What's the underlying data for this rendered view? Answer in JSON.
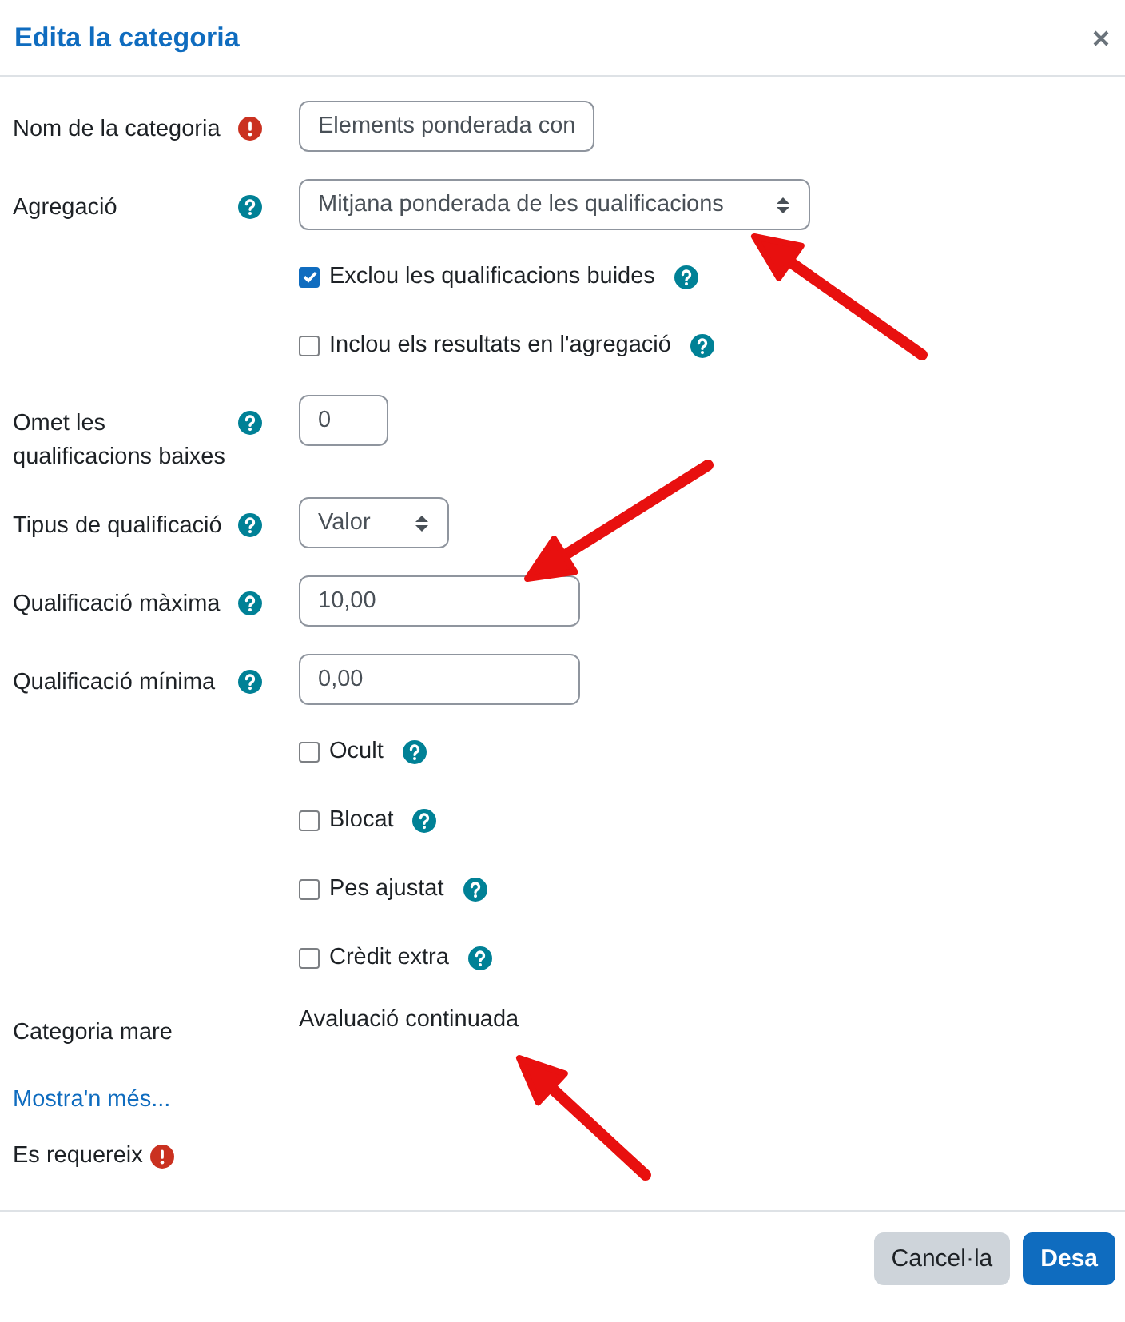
{
  "dialog": {
    "title": "Edita la categoria"
  },
  "rows": [
    {
      "kind": "text",
      "label": "Nom de la categoria",
      "required": true,
      "value": "Elements ponderada con"
    },
    {
      "kind": "select",
      "label": "Agregació",
      "required": false,
      "value": "Mitjana ponderada de les qualificacions"
    },
    {
      "kind": "checkbox",
      "text": "Exclou les qualificacions buides",
      "checked": true
    },
    {
      "kind": "checkbox",
      "text": "Inclou els resultats en l'agregació",
      "checked": false
    },
    {
      "kind": "text",
      "label": "Omet les qualificacions baixes",
      "required": false,
      "value": "0"
    },
    {
      "kind": "select",
      "label": "Tipus de qualificació",
      "required": false,
      "value": "Valor"
    },
    {
      "kind": "text",
      "label": "Qualificació màxima",
      "required": false,
      "value": "10,00"
    },
    {
      "kind": "text",
      "label": "Qualificació mínima",
      "required": false,
      "value": "0,00"
    },
    {
      "kind": "checkbox",
      "text": "Ocult",
      "checked": false
    },
    {
      "kind": "checkbox",
      "text": "Blocat",
      "checked": false
    },
    {
      "kind": "checkbox",
      "text": "Pes ajustat",
      "checked": false
    },
    {
      "kind": "checkbox",
      "text": "Crèdit extra",
      "checked": false
    },
    {
      "kind": "static",
      "label": "Categoria mare",
      "value": "Avaluació continuada"
    }
  ],
  "show_more_link": "Mostra'n més...",
  "required_note": "Es requereix",
  "buttons": [
    {
      "kind": "secondary",
      "label": "Cancel·la"
    },
    {
      "kind": "primary",
      "label": "Desa"
    }
  ]
}
